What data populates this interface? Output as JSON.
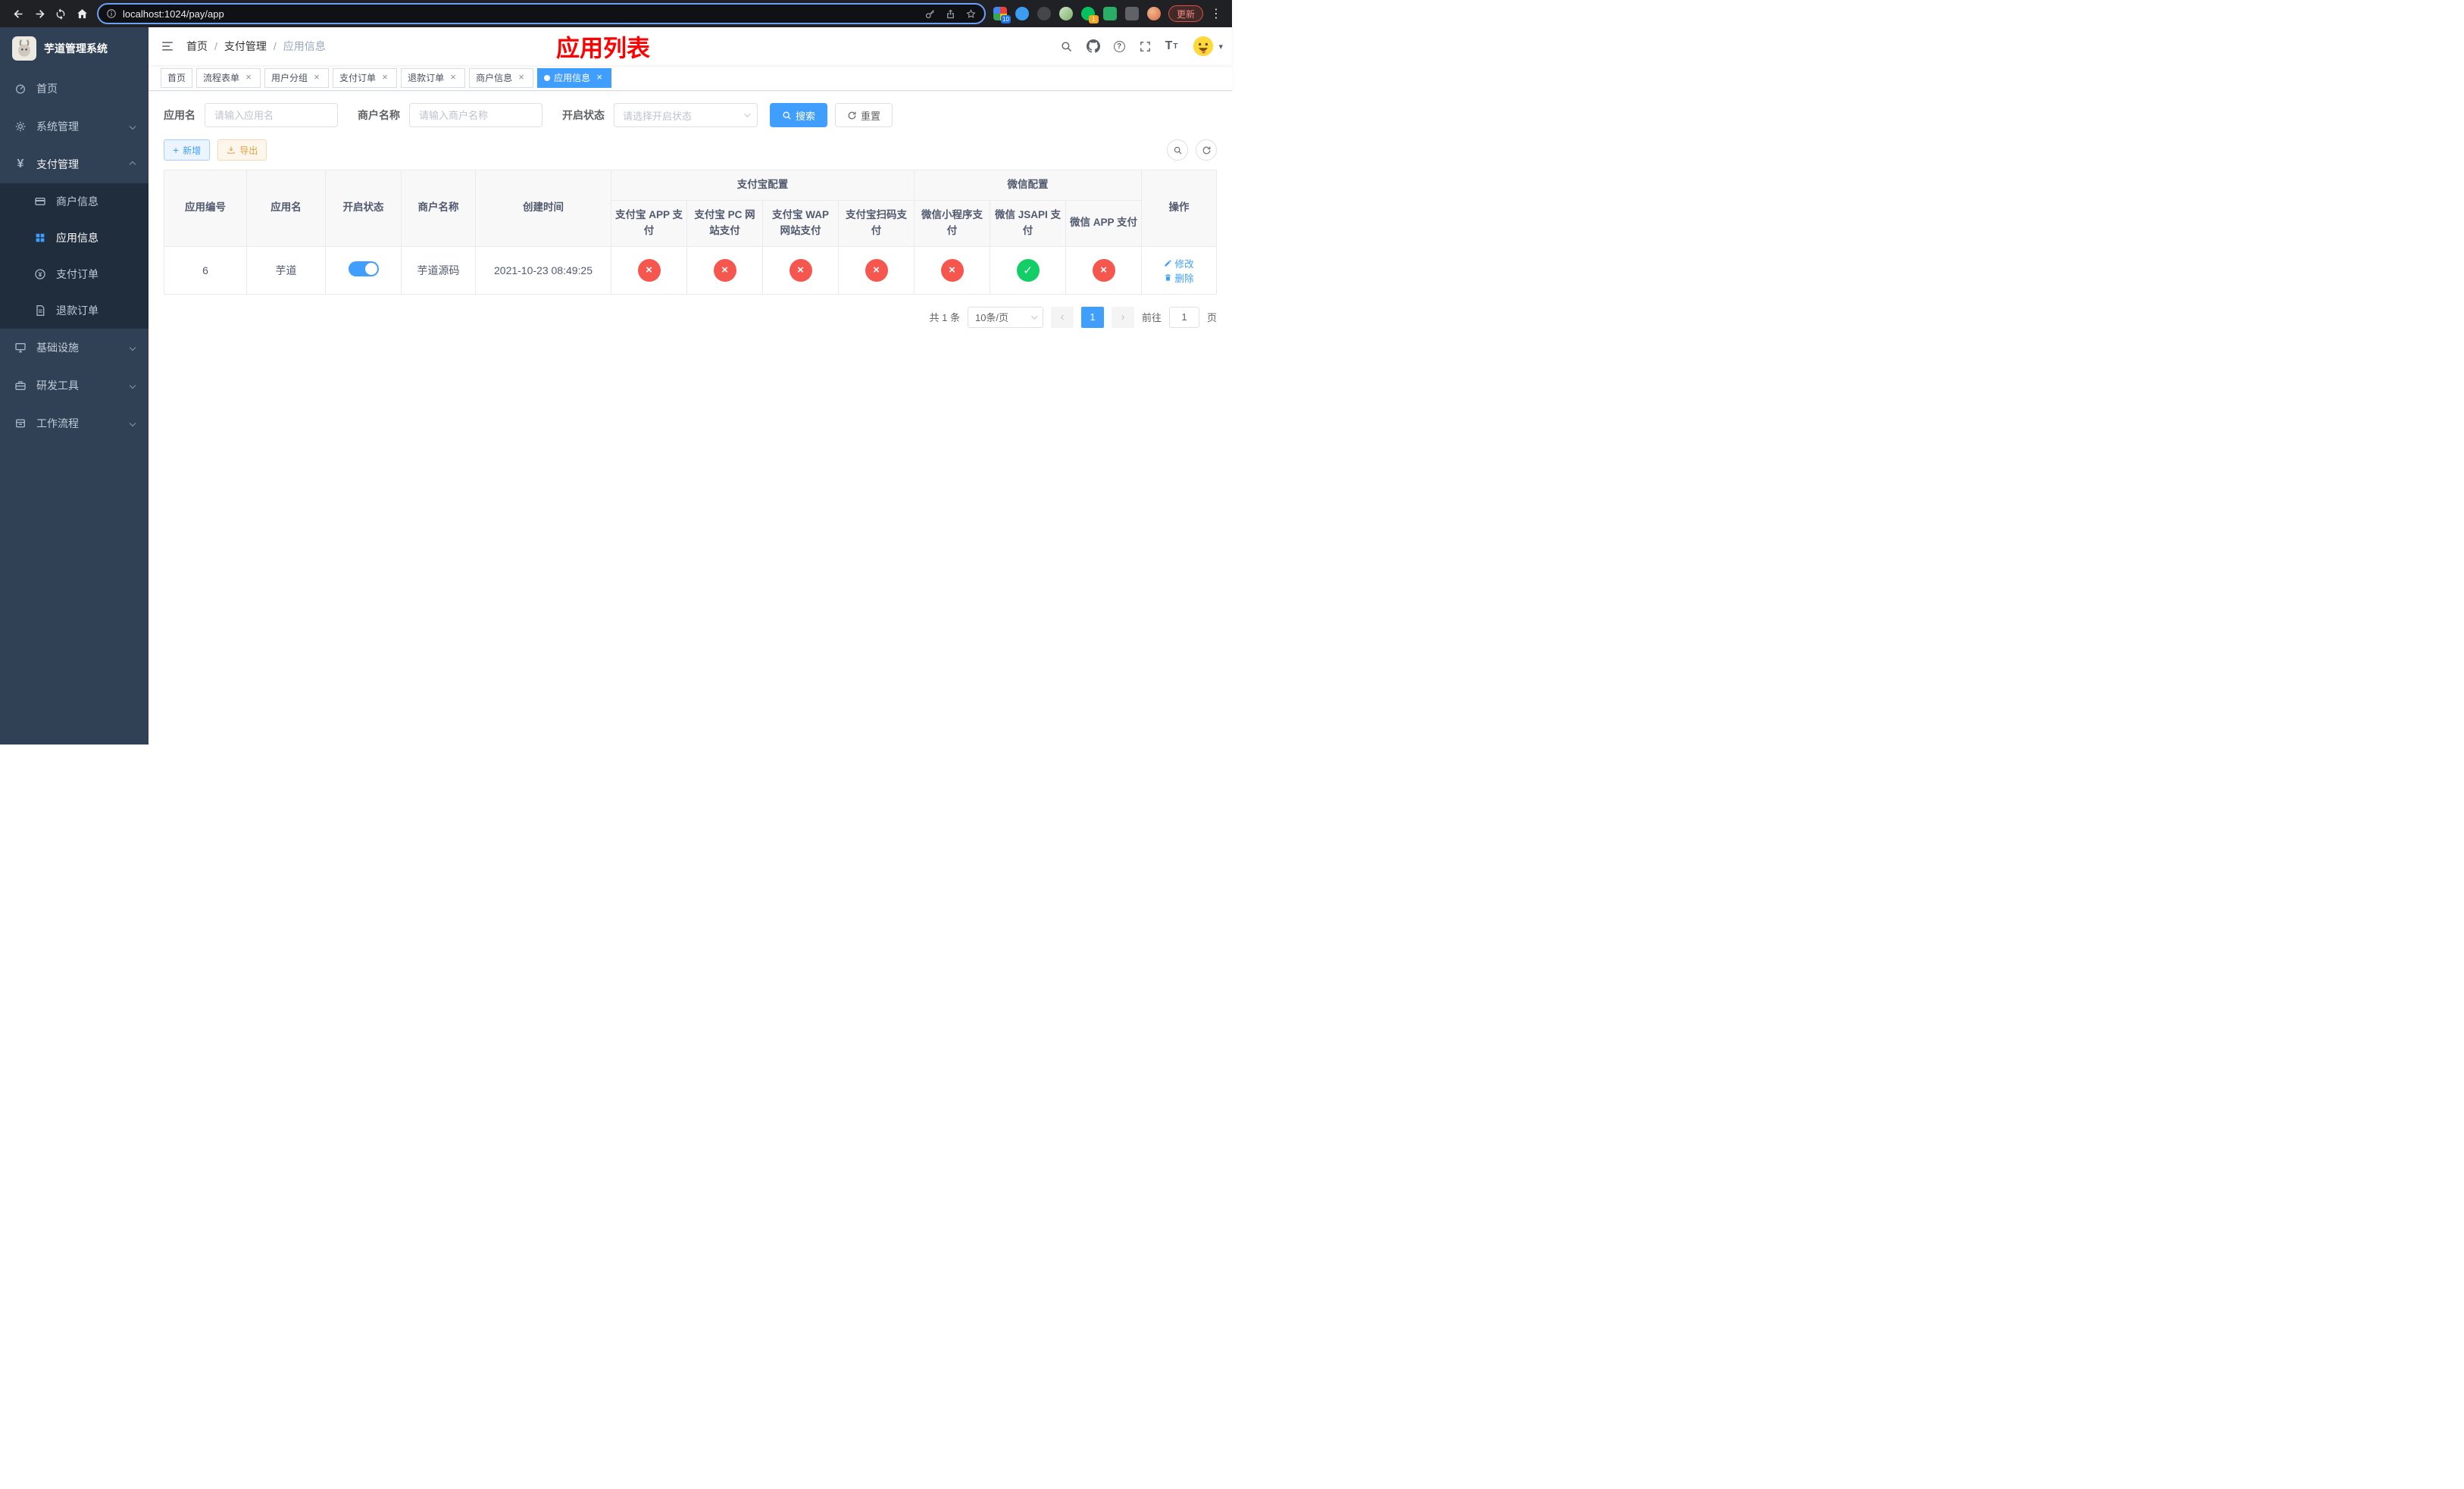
{
  "colors": {
    "primary": "#409eff",
    "success": "#13ce66",
    "danger": "#f5564e",
    "warning": "#e6a23c",
    "title_red": "#ff0000",
    "sidebar_bg": "#304156",
    "sidebar_sub_bg": "#1f2d3d"
  },
  "browser": {
    "url": "localhost:1024/pay/app",
    "update_label": "更新",
    "ext_badge_1": "10",
    "ext_badge_2": "1"
  },
  "icons": {
    "close_glyph": "×",
    "help_glyph": "?",
    "font_size_glyph": "T",
    "caret_glyph": "▾",
    "menu_dots_glyph": "⋮",
    "yen_glyph": "¥",
    "plus_glyph": "+",
    "prev_glyph": "‹",
    "next_glyph": "›"
  },
  "sidebar": {
    "logo_title": "芋道管理系统",
    "items": [
      {
        "label": "首页"
      },
      {
        "label": "系统管理"
      },
      {
        "label": "支付管理"
      },
      {
        "label": "基础设施"
      },
      {
        "label": "研发工具"
      },
      {
        "label": "工作流程"
      }
    ],
    "submenu": [
      {
        "label": "商户信息"
      },
      {
        "label": "应用信息"
      },
      {
        "label": "支付订单"
      },
      {
        "label": "退款订单"
      }
    ]
  },
  "header": {
    "breadcrumb": [
      {
        "label": "首页"
      },
      {
        "label": "支付管理"
      },
      {
        "label": "应用信息"
      }
    ],
    "separator": "/",
    "page_title": "应用列表"
  },
  "tabs": [
    {
      "label": "首页"
    },
    {
      "label": "流程表单"
    },
    {
      "label": "用户分组"
    },
    {
      "label": "支付订单"
    },
    {
      "label": "退款订单"
    },
    {
      "label": "商户信息"
    },
    {
      "label": "应用信息"
    }
  ],
  "filters": {
    "app_name_label": "应用名",
    "app_name_placeholder": "请输入应用名",
    "merchant_label": "商户名称",
    "merchant_placeholder": "请输入商户名称",
    "status_label": "开启状态",
    "status_placeholder": "请选择开启状态",
    "search_label": "搜索",
    "reset_label": "重置"
  },
  "toolbar": {
    "add_label": "新增",
    "export_label": "导出"
  },
  "table": {
    "headers": {
      "app_id": "应用编号",
      "app_name": "应用名",
      "status": "开启状态",
      "merchant": "商户名称",
      "created": "创建时间",
      "alipay_group": "支付宝配置",
      "wechat_group": "微信配置",
      "alipay_app": "支付宝 APP 支付",
      "alipay_pc": "支付宝 PC 网站支付",
      "alipay_wap": "支付宝 WAP 网站支付",
      "alipay_scan": "支付宝扫码支付",
      "wechat_mini": "微信小程序支付",
      "wechat_jsapi": "微信 JSAPI 支付",
      "wechat_app": "微信 APP 支付",
      "actions": "操作"
    },
    "row": {
      "app_id": "6",
      "app_name": "芋道",
      "status_state": "on",
      "merchant": "芋道源码",
      "created": "2021-10-23 08:49:25",
      "configs": [
        {
          "state": "no",
          "glyph": "×"
        },
        {
          "state": "no",
          "glyph": "×"
        },
        {
          "state": "no",
          "glyph": "×"
        },
        {
          "state": "no",
          "glyph": "×"
        },
        {
          "state": "no",
          "glyph": "×"
        },
        {
          "state": "yes",
          "glyph": "✓"
        },
        {
          "state": "no",
          "glyph": "×"
        }
      ],
      "edit_label": "修改",
      "delete_label": "删除"
    }
  },
  "pagination": {
    "total": "共 1 条",
    "page_size": "10条/页",
    "current_page": "1",
    "goto_label": "前往",
    "goto_value": "1",
    "unit_label": "页"
  }
}
